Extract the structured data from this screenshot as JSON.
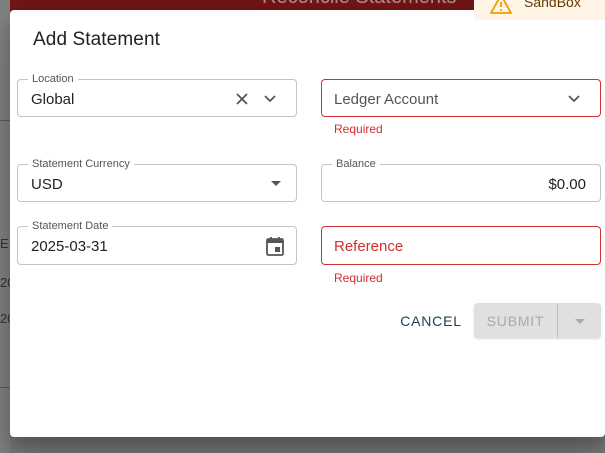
{
  "background": {
    "header_title": "Reconcile Statements",
    "row_chars": [
      "E",
      "20",
      "20"
    ]
  },
  "sandbox": {
    "label": "SandBox",
    "icon": "warning-icon",
    "color": "#663c00"
  },
  "dialog": {
    "title": "Add Statement",
    "fields": {
      "location": {
        "label": "Location",
        "value": "Global",
        "icons": [
          "clear-icon",
          "chevron-down-icon"
        ]
      },
      "ledger_account": {
        "placeholder": "Ledger Account",
        "helper": "Required",
        "icon": "chevron-down-icon"
      },
      "statement_currency": {
        "label": "Statement Currency",
        "value": "USD",
        "icon": "caret-down-icon"
      },
      "balance": {
        "label": "Balance",
        "value": "$0.00"
      },
      "statement_date": {
        "label": "Statement Date",
        "value": "2025-03-31",
        "icon": "calendar-icon"
      },
      "reference": {
        "placeholder": "Reference",
        "helper": "Required"
      }
    },
    "actions": {
      "cancel": "CANCEL",
      "submit": "SUBMIT",
      "submit_dropdown_icon": "caret-down-icon"
    }
  },
  "colors": {
    "error": "#d32f2f",
    "header": "#6e1515",
    "sandbox_bg": "#fff4e5",
    "cancel_text": "#1e3f4e",
    "disabled_bg": "#e0e0e0"
  }
}
